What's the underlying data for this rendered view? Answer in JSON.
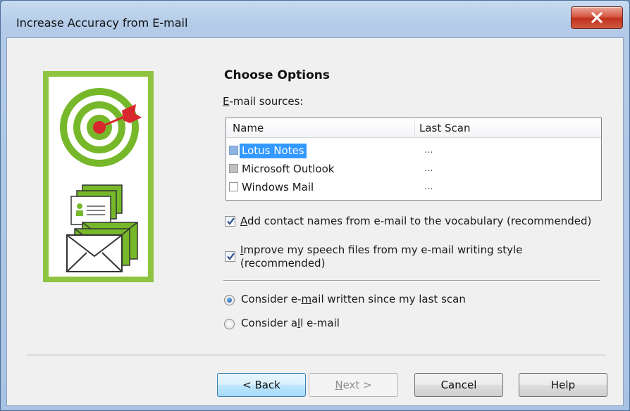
{
  "window": {
    "title": "Increase Accuracy from E-mail",
    "close_icon": "close-icon"
  },
  "page": {
    "heading": "Choose Options",
    "sources_label_mnemonic": "E",
    "sources_label_rest": "-mail sources:"
  },
  "listview": {
    "columns": [
      "Name",
      "Last Scan"
    ],
    "rows": [
      {
        "name": "Lotus Notes",
        "last_scan": "...",
        "state": "selected"
      },
      {
        "name": "Microsoft Outlook",
        "last_scan": "...",
        "state": "disabled"
      },
      {
        "name": "Windows Mail",
        "last_scan": "...",
        "state": "unchecked"
      }
    ]
  },
  "options": {
    "add_contacts": {
      "checked": true,
      "mnemonic": "A",
      "rest": "dd contact names from e-mail to the vocabulary (recommended)"
    },
    "improve_speech": {
      "checked": true,
      "mnemonic": "I",
      "rest_line1": "mprove my speech files from my e-mail writing style",
      "line2": "(recommended)"
    }
  },
  "scan_mode": {
    "since_last": {
      "selected": true,
      "before": "Consider e-",
      "mnemonic": "m",
      "after": "ail written since my last scan"
    },
    "all": {
      "selected": false,
      "before": "Consider a",
      "mnemonic": "l",
      "after": "l e-mail"
    }
  },
  "buttons": {
    "back": "< Back",
    "next_mnemonic": "N",
    "next_rest": "ext >",
    "cancel": "Cancel",
    "help": "Help"
  },
  "colors": {
    "illustration_green": "#8ec43f",
    "target_green": "#76b82a",
    "dart_red": "#d9272e",
    "selection_blue": "#3399ff"
  }
}
